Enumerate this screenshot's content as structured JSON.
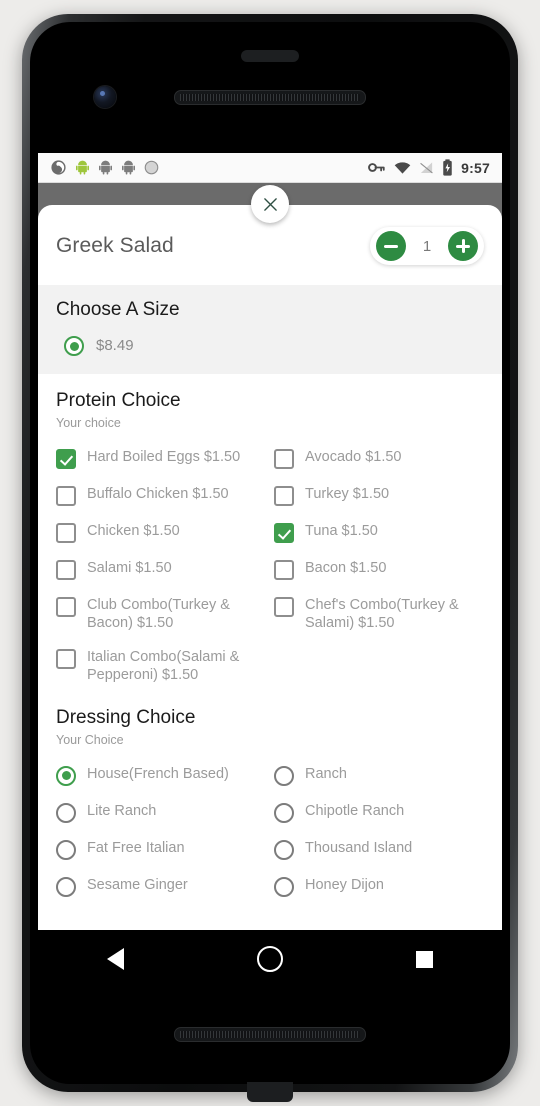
{
  "status_bar": {
    "time": "9:57",
    "left_icons": [
      "sync-icon",
      "android-robot-icon",
      "android-robot-icon-2",
      "android-robot-icon-3",
      "circle-icon"
    ],
    "right_icons": [
      "vpn-key-icon",
      "wifi-icon",
      "cell-signal-off-icon",
      "battery-charging-icon"
    ]
  },
  "modal": {
    "close_label": "×",
    "item": {
      "title": "Greek Salad",
      "quantity": "1",
      "decrement_label": "−",
      "increment_label": "+"
    },
    "sections": [
      {
        "id": "size",
        "title": "Choose A Size",
        "subtitle": "",
        "type": "radio",
        "options": [
          {
            "label": "$8.49",
            "selected": true
          }
        ]
      },
      {
        "id": "protein",
        "title": "Protein Choice",
        "subtitle": "Your choice",
        "type": "checkbox",
        "options": [
          {
            "label": "Hard Boiled Eggs $1.50",
            "selected": true
          },
          {
            "label": "Avocado $1.50",
            "selected": false
          },
          {
            "label": "Buffalo Chicken $1.50",
            "selected": false
          },
          {
            "label": "Turkey $1.50",
            "selected": false
          },
          {
            "label": "Chicken $1.50",
            "selected": false
          },
          {
            "label": "Tuna $1.50",
            "selected": true
          },
          {
            "label": "Salami $1.50",
            "selected": false
          },
          {
            "label": "Bacon $1.50",
            "selected": false
          },
          {
            "label": "Club Combo(Turkey & Bacon) $1.50",
            "selected": false
          },
          {
            "label": "Chef's Combo(Turkey & Salami) $1.50",
            "selected": false
          },
          {
            "label": "Italian Combo(Salami & Pepperoni) $1.50",
            "selected": false
          }
        ]
      },
      {
        "id": "dressing",
        "title": "Dressing Choice",
        "subtitle": "Your Choice",
        "type": "radio",
        "options": [
          {
            "label": "House(French Based)",
            "selected": true
          },
          {
            "label": "Ranch",
            "selected": false
          },
          {
            "label": "Lite Ranch",
            "selected": false
          },
          {
            "label": "Chipotle Ranch",
            "selected": false
          },
          {
            "label": "Fat Free Italian",
            "selected": false
          },
          {
            "label": "Thousand Island",
            "selected": false
          },
          {
            "label": "Sesame Ginger",
            "selected": false
          },
          {
            "label": "Honey Dijon",
            "selected": false
          }
        ]
      }
    ]
  },
  "nav_bar": {
    "back_label": "back-button",
    "home_label": "home-button",
    "recents_label": "recents-button"
  },
  "colors": {
    "accent_green": "#3f9e4d",
    "stepper_green": "#2e8b42",
    "backdrop": "#6b6b6b",
    "size_block_bg": "#f2f2f2",
    "label_grey": "#9b9b9b"
  }
}
